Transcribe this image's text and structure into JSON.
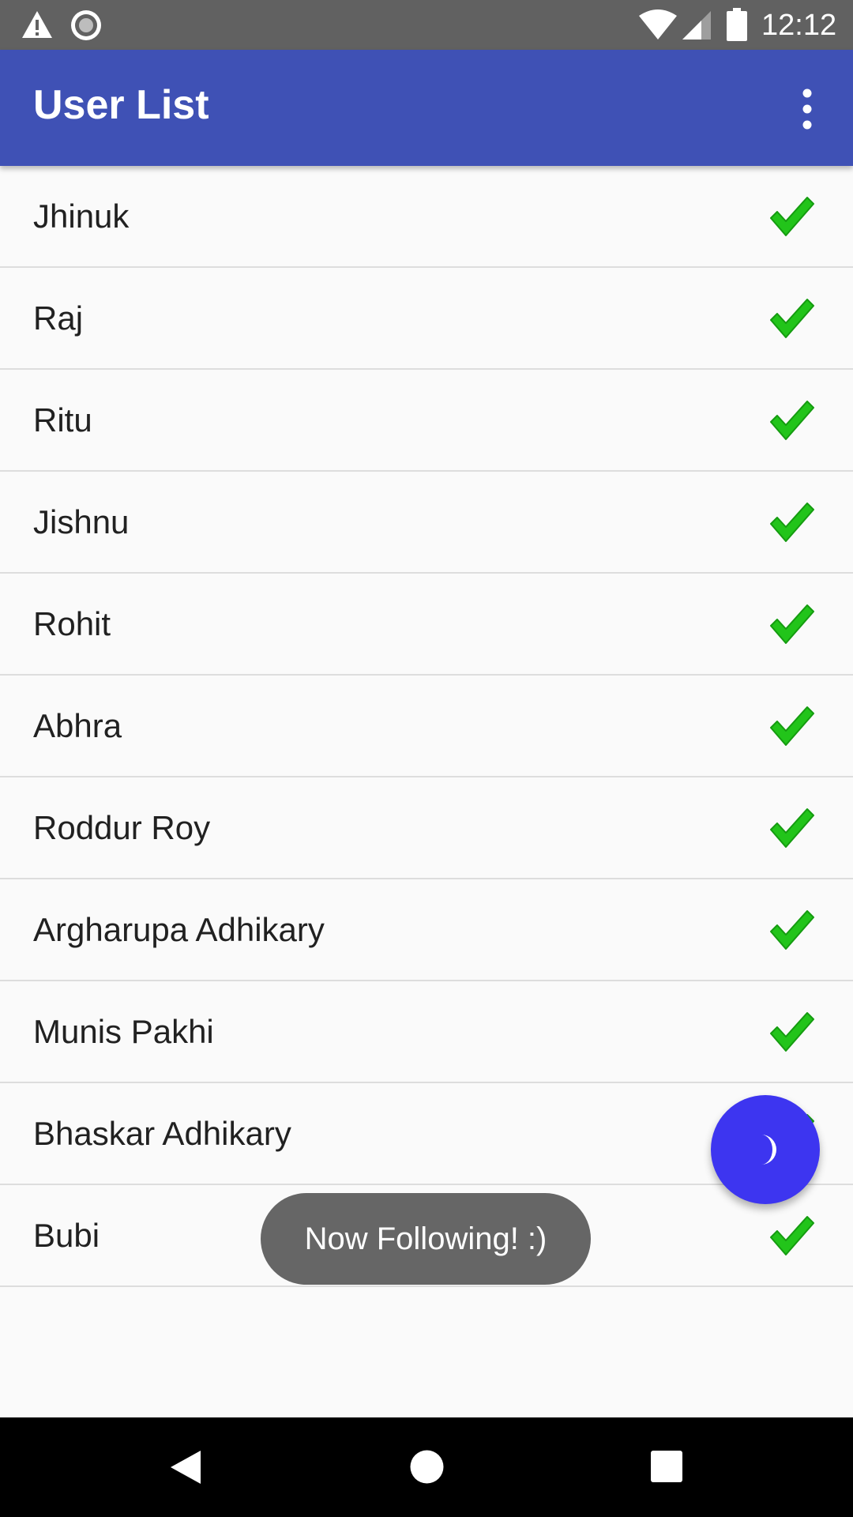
{
  "status_bar": {
    "time": "12:12",
    "icons": [
      "warning-icon",
      "record-icon",
      "wifi-icon",
      "signal-icon",
      "battery-icon"
    ]
  },
  "app_bar": {
    "title": "User List",
    "menu_icon": "overflow-menu-icon",
    "color": "#3f51b5"
  },
  "users": [
    {
      "name": "Jhinuk",
      "followed": true
    },
    {
      "name": "Raj",
      "followed": true
    },
    {
      "name": "Ritu",
      "followed": true
    },
    {
      "name": "Jishnu",
      "followed": true
    },
    {
      "name": "Rohit",
      "followed": true
    },
    {
      "name": "Abhra",
      "followed": true
    },
    {
      "name": "Roddur Roy",
      "followed": true
    },
    {
      "name": "Argharupa Adhikary",
      "followed": true
    },
    {
      "name": "Munis Pakhi",
      "followed": true
    },
    {
      "name": "Bhaskar Adhikary",
      "followed": true
    },
    {
      "name": "Bubi",
      "followed": true
    }
  ],
  "check_color": "#22c41a",
  "fab": {
    "icon": "moon-icon",
    "color": "#3d35f0"
  },
  "toast": {
    "text": "Now Following! :)"
  },
  "nav_bar": {
    "icons": [
      "back-icon",
      "home-icon",
      "recents-icon"
    ]
  }
}
